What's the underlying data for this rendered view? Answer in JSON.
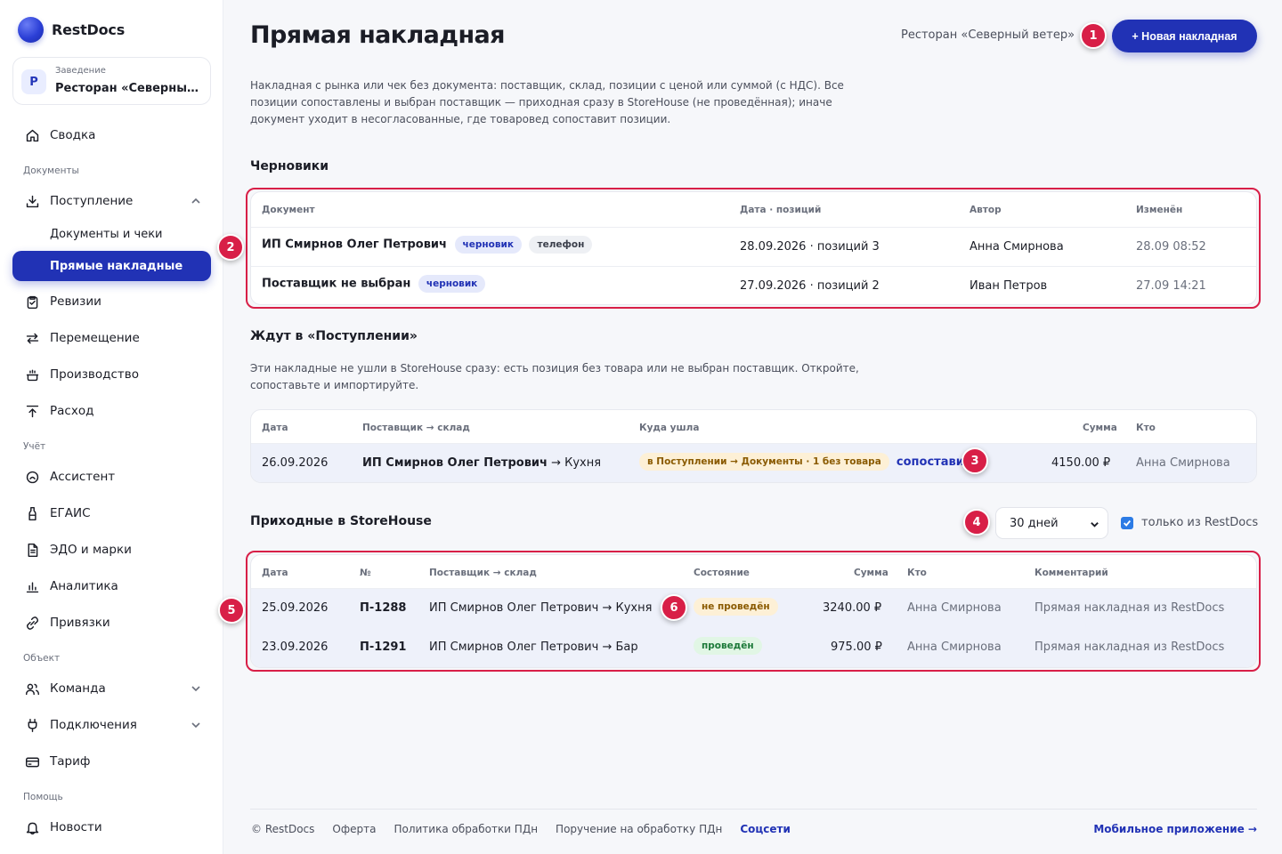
{
  "brand": "RestDocs",
  "venue": {
    "avatar": "Р",
    "label": "Заведение",
    "name": "Ресторан «Северный ветер»"
  },
  "nav": {
    "svodka": "Сводка",
    "section_docs": "Документы",
    "postuplenie": "Поступление",
    "docs_checks": "Документы и чеки",
    "direct": "Прямые накладные",
    "revisii": "Ревизии",
    "peremeshchenie": "Перемещение",
    "proizvodstvo": "Производство",
    "rashod": "Расход",
    "section_uchet": "Учёт",
    "assistant": "Ассистент",
    "egais": "ЕГАИС",
    "edo": "ЭДО и марки",
    "analytics": "Аналитика",
    "privyazki": "Привязки",
    "section_object": "Объект",
    "team": "Команда",
    "connections": "Подключения",
    "tariff": "Тариф",
    "section_help": "Помощь",
    "news": "Новости"
  },
  "header": {
    "title": "Прямая накладная",
    "venue": "Ресторан «Северный ветер»",
    "new_button": "+ Новая накладная"
  },
  "intro": "Накладная с рынка или чек без документа: поставщик, склад, позиции с ценой или суммой (с НДС). Все позиции сопоставлены и выбран поставщик — приходная сразу в StoreHouse (не проведённая); иначе документ уходит в несогласованные, где товаровед сопоставит позиции.",
  "drafts": {
    "title": "Черновики",
    "columns": {
      "doc": "Документ",
      "date": "Дата · позиций",
      "author": "Автор",
      "changed": "Изменён"
    },
    "rows": [
      {
        "doc": "ИП Смирнов Олег Петрович",
        "chip1": "черновик",
        "chip2": "телефон",
        "date": "28.09.2026 · позиций 3",
        "author": "Анна Смирнова",
        "changed": "28.09 08:52"
      },
      {
        "doc": "Поставщик не выбран",
        "chip1": "черновик",
        "date": "27.09.2026 · позиций 2",
        "author": "Иван Петров",
        "changed": "27.09 14:21"
      }
    ]
  },
  "waiting": {
    "title": "Ждут в «Поступлении»",
    "desc": "Эти накладные не ушли в StoreHouse сразу: есть позиция без товара или не выбран поставщик. Откройте, сопоставьте и импортируйте.",
    "columns": {
      "date": "Дата",
      "supplier": "Поставщик → склад",
      "where": "Куда ушла",
      "sum": "Сумма",
      "who": "Кто"
    },
    "rows": [
      {
        "date": "26.09.2026",
        "supplier": "ИП Смирнов Олег Петрович",
        "warehouse": "→ Кухня",
        "where": "в Поступлении → Документы · 1 без товара",
        "action": "сопоставить",
        "sum": "4150.00 ₽",
        "who": "Анна Смирнова"
      }
    ]
  },
  "incoming": {
    "title": "Приходные в StoreHouse",
    "period": "30 дней",
    "only_restdocs": "только из RestDocs",
    "columns": {
      "date": "Дата",
      "num": "№",
      "supplier": "Поставщик → склад",
      "state": "Состояние",
      "sum": "Сумма",
      "who": "Кто",
      "comment": "Комментарий"
    },
    "rows": [
      {
        "date": "25.09.2026",
        "num": "П-1288",
        "supplier": "ИП Смирнов Олег Петрович → Кухня",
        "state": "не проведён",
        "sum": "3240.00 ₽",
        "who": "Анна Смирнова",
        "comment": "Прямая накладная из RestDocs"
      },
      {
        "date": "23.09.2026",
        "num": "П-1291",
        "supplier": "ИП Смирнов Олег Петрович → Бар",
        "state": "проведён",
        "sum": "975.00 ₽",
        "who": "Анна Смирнова",
        "comment": "Прямая накладная из RestDocs"
      }
    ]
  },
  "markers": [
    "1",
    "2",
    "3",
    "4",
    "5",
    "6"
  ],
  "footer": {
    "copyright": "© RestDocs",
    "offer": "Оферта",
    "policy": "Политика обработки ПДн",
    "order": "Поручение на обработку ПДн",
    "social": "Соцсети",
    "mobile": "Мобильное приложение →"
  },
  "colors": {
    "accent": "#2132b5",
    "highlight": "#d81f47"
  }
}
